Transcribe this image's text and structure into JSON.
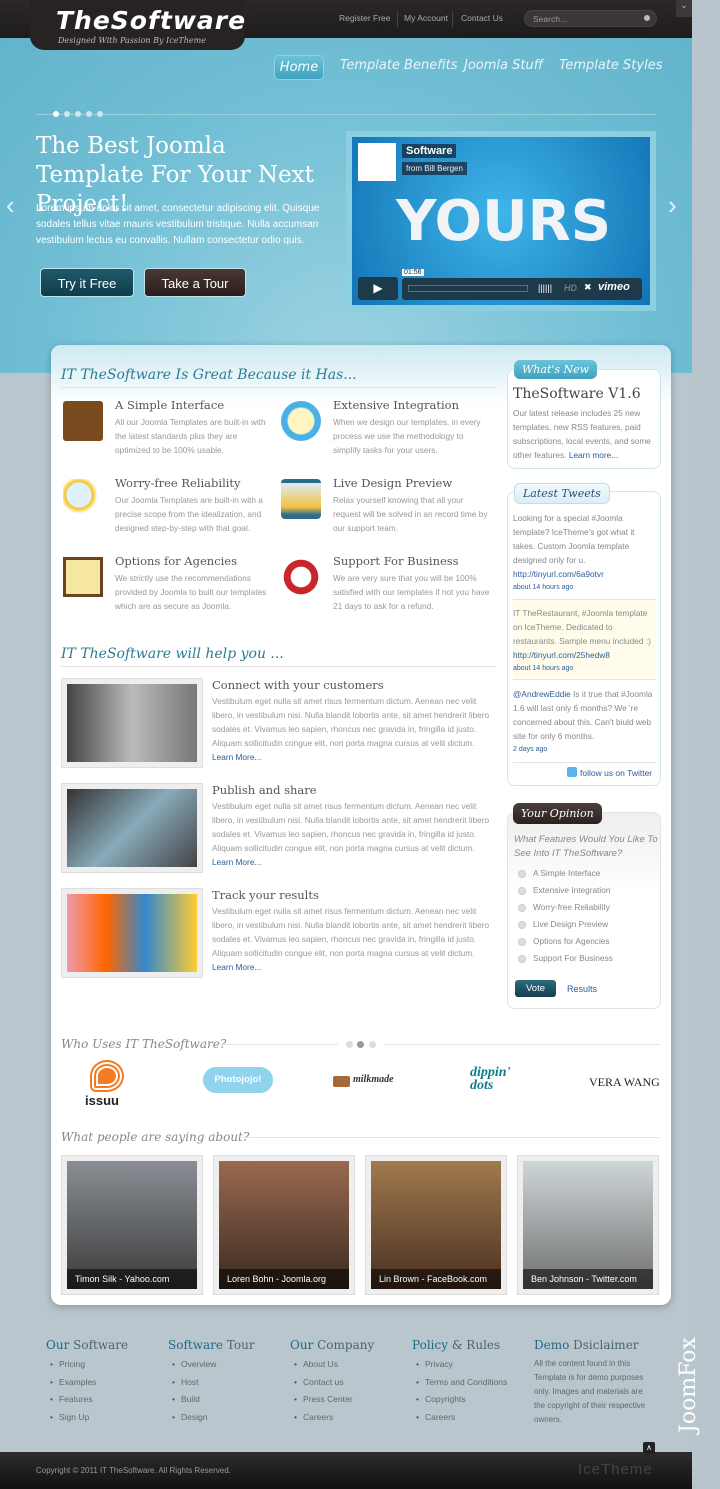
{
  "header": {
    "logo_title": "TheSoftware",
    "logo_tagline": "Designed With Passion By IceTheme",
    "top_links": [
      "Register Free",
      "My Account",
      "Contact Us"
    ],
    "search_placeholder": "Search..."
  },
  "nav": {
    "items": [
      "Home",
      "Template Benefits",
      "Joomla Stuff",
      "Template Styles"
    ],
    "active": "Home"
  },
  "hero": {
    "title": "The Best Joomla Template For Your Next Project!",
    "text": "Lorem ipsum dolor sit amet, consectetur adipiscing elit. Quisque sodales tellus vitae mauris vestibulum tristique. Nulla accumsan vestibulum lectus eu convallis. Nullam consectetur odio quis.",
    "btn_try": "Try it Free",
    "btn_tour": "Take a Tour",
    "slide_count": 5,
    "active_slide": 1,
    "video": {
      "title": "Software",
      "byline": "from Bill Bergen",
      "big_text": "YOURS",
      "time": "01:56",
      "hd": "HD",
      "brand": "vimeo"
    }
  },
  "features": {
    "heading": "IT TheSoftware Is Great Because it Has...",
    "items": [
      {
        "title": "A Simple Interface",
        "text": "All our Joomla Templates are built-in with the latest standards plus they are optimized to be 100% usable.",
        "icon": "address-book-icon"
      },
      {
        "title": "Extensive Integration",
        "text": "When we design our templates, in every process we use the methodology to simplify tasks for your users.",
        "icon": "alarm-clock-icon"
      },
      {
        "title": "Worry-free Reliability",
        "text": "Our Joomla Templates are built-in with a precise scope from the idealization, and designed step-by-step with that goal.",
        "icon": "magnifier-icon"
      },
      {
        "title": "Live Design Preview",
        "text": "Relax yourself knowing that all your request will be solved in an record time by our support team.",
        "icon": "hourglass-icon"
      },
      {
        "title": "Options for Agencies",
        "text": "We strictly use the recommendations provided by Joomla to built our templates which are as secure as Joomla.",
        "icon": "clipboard-icon"
      },
      {
        "title": "Support For Business",
        "text": "We are very sure that you will be 100% satisfied with our templates if not you have 21 days to ask for a refund.",
        "icon": "lifebuoy-icon"
      }
    ]
  },
  "help": {
    "heading": "IT TheSoftware will help you ...",
    "items": [
      {
        "title": "Connect with your customers",
        "text": "Vestibulum eget nulla sit amet risus fermentum dictum. Aenean nec velit libero, in vestibulum nisi. Nulla blandit lobortis ante, sit amet hendrerit libero sodales et. Vivamus leo sapien, rhoncus nec gravida in, fringilla id justo. Aliquam sollicitudin congue elit, non porta magna cursus at velit dictum.",
        "link": "Learn More..."
      },
      {
        "title": "Publish and share",
        "text": "Vestibulum eget nulla sit amet risus fermentum dictum. Aenean nec velit libero, in vestibulum nisi. Nulla blandit lobortis ante, sit amet hendrerit libero sodales et. Vivamus leo sapien, rhoncus nec gravida in, fringilla id justo. Aliquam sollicitudin congue elit, non porta magna cursus at velit dictum.",
        "link": "Learn More..."
      },
      {
        "title": "Track your results",
        "text": "Vestibulum eget nulla sit amet risus fermentum dictum. Aenean nec velit libero, in vestibulum nisi. Nulla blandit lobortis ante, sit amet hendrerit libero sodales et. Vivamus leo sapien, rhoncus nec gravida in, fringilla id justo. Aliquam sollicitudin congue elit, non porta magna cursus at velit dictum.",
        "link": "Learn More..."
      }
    ]
  },
  "whats_new": {
    "badge": "What's New",
    "title": "TheSoftware V1.6",
    "text": "Our latest release includes 25 new templates, new RSS features, paid subscriptions, local events, and some other features.",
    "link": "Learn more..."
  },
  "tweets": {
    "badge": "Latest Tweets",
    "items": [
      {
        "text": "Looking for a special #Joomla template? IceTheme's got what it takes. Custom Joomla template designed only for u.",
        "link": "http://tinyurl.com/6a9otvr",
        "ago": "about 14 hours ago"
      },
      {
        "text": "IT TheRestaurant, #Joomla template on IceTheme. Dedicated to restaurants. Sample menu included :)",
        "link": "http://tinyurl.com/25hedw8",
        "ago": "about 14 hours ago"
      },
      {
        "mention": "@AndrewEddie",
        "text": " Is it true that #Joomla 1.6 will last only 6 months? We 're concerned about this. Can't biuld web site for only 6 months.",
        "ago": "2 days ago"
      }
    ],
    "follow": "follow us on Twitter"
  },
  "poll": {
    "badge": "Your Opinion",
    "question": "What Features Would You Like To See Into IT TheSoftware?",
    "options": [
      "A Simple Interface",
      "Extensive Integration",
      "Worry-free Reliability",
      "Live Design Preview",
      "Options for Agencies",
      "Support For Business"
    ],
    "vote": "Vote",
    "results": "Results"
  },
  "clients": {
    "heading": "Who Uses IT TheSoftware?",
    "logos": [
      "issuu",
      "Photojojo!",
      "milkmade",
      "dippin' dots",
      "VERA WANG"
    ],
    "page_count": 3,
    "active_page": 2
  },
  "testimonials": {
    "heading": "What people are saying about?",
    "items": [
      "Timon Silk - Yahoo.com",
      "Loren Bohn - Joomla.org",
      "Lin Brown - FaceBook.com",
      "Ben Johnson - Twitter.com"
    ]
  },
  "footer": {
    "columns": [
      {
        "title_a": "Our",
        "title_b": " Software",
        "links": [
          "Pricing",
          "Examples",
          "Features",
          "Sign Up"
        ]
      },
      {
        "title_a": "Software",
        "title_b": " Tour",
        "links": [
          "Overview",
          "Host",
          "Build",
          "Design"
        ]
      },
      {
        "title_a": "Our",
        "title_b": " Company",
        "links": [
          "About Us",
          "Contact us",
          "Press Center",
          "Careers"
        ]
      },
      {
        "title_a": "Policy",
        "title_b": " & Rules",
        "links": [
          "Privacy",
          "Terms and Conditions",
          "Copyrights",
          "Careers"
        ]
      }
    ],
    "disclaimer": {
      "title_a": "Demo",
      "title_b": " Dsiclaimer",
      "text": "All the content found in this Template is for demo purposes only. Images and materials are the copyright of their respective owners."
    },
    "copyright": "Copyright © 2011 IT TheSoftware. All Rights Reserved.",
    "brand": "IceTheme",
    "side_logo": "JoomFox"
  },
  "colors": {
    "accent": "#2c7c94",
    "hero": "#71bfd5",
    "dark": "#262322",
    "link": "#2c5d9a"
  }
}
